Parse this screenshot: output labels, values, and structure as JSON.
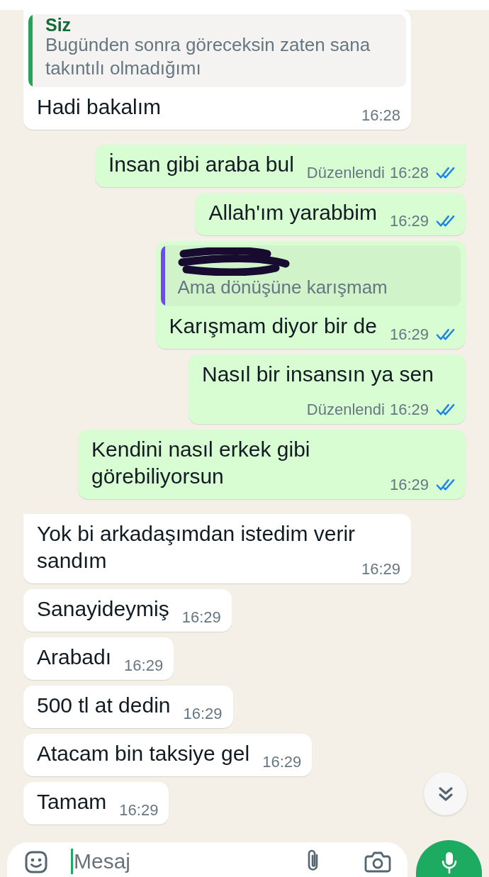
{
  "messages": [
    {
      "kind": "incoming",
      "quote": {
        "author": "Siz",
        "text": "Bugünden sonra göreceksin zaten sana takıntılı olmadığımı",
        "color": "#25a35a"
      },
      "text": "Hadi bakalım",
      "time": "16:28"
    },
    {
      "kind": "outgoing",
      "text": "İnsan gibi araba bul",
      "edited_label": "Düzenlendi",
      "time": "16:28",
      "read": true
    },
    {
      "kind": "outgoing",
      "text": "Allah'ım yarabbim",
      "time": "16:29",
      "read": true
    },
    {
      "kind": "outgoing",
      "quote": {
        "redacted": true,
        "text": "Ama dönüşüne karışmam",
        "color": "#6b4fe5"
      },
      "text": "Karışmam diyor bir de",
      "time": "16:29",
      "read": true
    },
    {
      "kind": "outgoing",
      "text": "Nasıl bir insansın ya sen",
      "edited_label": "Düzenlendi",
      "time": "16:29",
      "read": true
    },
    {
      "kind": "outgoing",
      "text": "Kendini nasıl erkek gibi görebiliyorsun",
      "time": "16:29",
      "read": true
    },
    {
      "kind": "incoming",
      "text": "Yok bi arkadaşımdan istedim verir sandım",
      "time": "16:29"
    },
    {
      "kind": "incoming",
      "text": "Sanayideymiş",
      "time": "16:29"
    },
    {
      "kind": "incoming",
      "text": "Arabadı",
      "time": "16:29"
    },
    {
      "kind": "incoming",
      "text": "500 tl at dedin",
      "time": "16:29"
    },
    {
      "kind": "incoming",
      "text": "Atacam bin taksiye gel",
      "time": "16:29"
    },
    {
      "kind": "incoming",
      "text": "Tamam",
      "time": "16:29"
    }
  ],
  "composer": {
    "placeholder": "Mesaj"
  }
}
